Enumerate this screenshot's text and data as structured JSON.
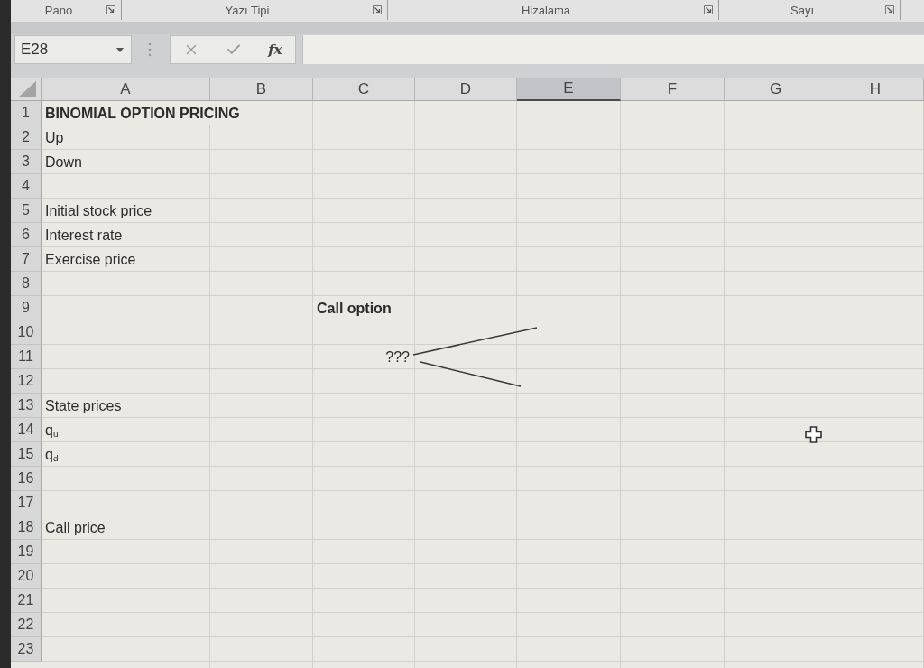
{
  "ribbon": {
    "groups": [
      {
        "label": "Pano"
      },
      {
        "label": "Yazı Tipi"
      },
      {
        "label": "Hizalama"
      },
      {
        "label": "Sayı"
      }
    ]
  },
  "formula_bar": {
    "name_box": "E28",
    "function_button": "fx"
  },
  "sheet": {
    "columns": [
      {
        "label": "A",
        "selected": false
      },
      {
        "label": "B",
        "selected": false
      },
      {
        "label": "C",
        "selected": false
      },
      {
        "label": "D",
        "selected": false
      },
      {
        "label": "E",
        "selected": true
      },
      {
        "label": "F",
        "selected": false
      },
      {
        "label": "G",
        "selected": false
      },
      {
        "label": "H",
        "selected": false
      }
    ],
    "rows": [
      {
        "number": "1",
        "cells": [
          {
            "kind": "heading",
            "text": "BINOMIAL OPTION PRICING"
          }
        ]
      },
      {
        "number": "2",
        "cells": [
          {
            "kind": "label",
            "text": "Up"
          }
        ]
      },
      {
        "number": "3",
        "cells": [
          {
            "kind": "label",
            "text": "Down"
          }
        ]
      },
      {
        "number": "4"
      },
      {
        "number": "5",
        "cells": [
          {
            "kind": "label",
            "text": "Initial stock price"
          }
        ]
      },
      {
        "number": "6",
        "cells": [
          {
            "kind": "label",
            "text": "Interest rate"
          }
        ]
      },
      {
        "number": "7",
        "cells": [
          {
            "kind": "label",
            "text": "Exercise price"
          }
        ]
      },
      {
        "number": "8"
      },
      {
        "number": "9",
        "cells": [
          null,
          null,
          {
            "kind": "heading",
            "text": "Call option"
          }
        ]
      },
      {
        "number": "10"
      },
      {
        "number": "11",
        "cells": [
          null,
          null,
          {
            "kind": "value",
            "text": "???"
          }
        ]
      },
      {
        "number": "12"
      },
      {
        "number": "13",
        "cells": [
          {
            "kind": "label",
            "text": "State prices"
          }
        ]
      },
      {
        "number": "14",
        "cells": [
          {
            "kind": "label",
            "text": "q$_{u}$"
          }
        ]
      },
      {
        "number": "15",
        "cells": [
          {
            "kind": "label",
            "text": "q$_{d}$"
          }
        ]
      },
      {
        "number": "16"
      },
      {
        "number": "17"
      },
      {
        "number": "18",
        "cells": [
          {
            "kind": "label",
            "text": "Call price"
          }
        ]
      },
      {
        "number": "19"
      },
      {
        "number": "20"
      },
      {
        "number": "21"
      },
      {
        "number": "22"
      },
      {
        "number": "23"
      }
    ]
  }
}
